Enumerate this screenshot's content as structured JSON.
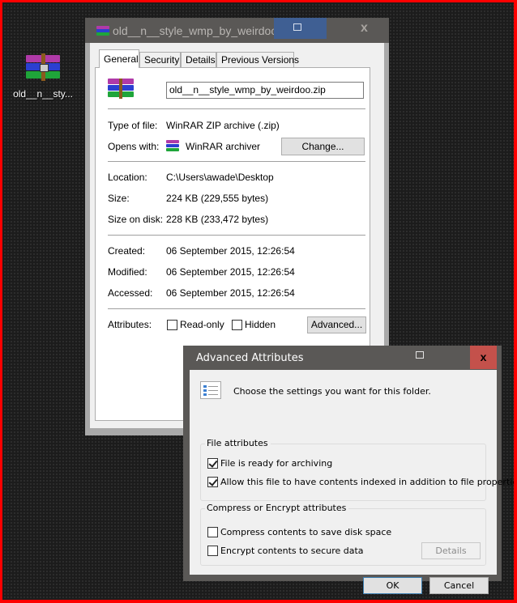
{
  "desktop": {
    "icon_label": "old__n__sty..."
  },
  "properties_window": {
    "title": "old__n__style_wmp_by_weirdoo.zip Prope",
    "tabs": [
      {
        "label": "General",
        "active": true
      },
      {
        "label": "Security",
        "active": false
      },
      {
        "label": "Details",
        "active": false
      },
      {
        "label": "Previous Versions",
        "active": false
      }
    ],
    "file_name": "old__n__style_wmp_by_weirdoo.zip",
    "type_of_file_label": "Type of file:",
    "type_of_file_value": "WinRAR ZIP archive (.zip)",
    "opens_with_label": "Opens with:",
    "opens_with_value": "WinRAR archiver",
    "change_button": "Change...",
    "location_label": "Location:",
    "location_value": "C:\\Users\\awade\\Desktop",
    "size_label": "Size:",
    "size_value": "224 KB (229,555 bytes)",
    "size_on_disk_label": "Size on disk:",
    "size_on_disk_value": "228 KB (233,472 bytes)",
    "created_label": "Created:",
    "created_value": "06 September 2015, 12:26:54",
    "modified_label": "Modified:",
    "modified_value": "06 September 2015, 12:26:54",
    "accessed_label": "Accessed:",
    "accessed_value": "06 September 2015, 12:26:54",
    "attributes_label": "Attributes:",
    "readonly_label": "Read-only",
    "readonly_checked": false,
    "hidden_label": "Hidden",
    "hidden_checked": false,
    "advanced_button": "Advanced...",
    "close_glyph": "x"
  },
  "advanced_dialog": {
    "title": "Advanced Attributes",
    "close_glyph": "x",
    "intro": "Choose the settings you want for this folder.",
    "file_attributes_group": "File attributes",
    "archive_label": "File is ready for archiving",
    "archive_checked": true,
    "index_label": "Allow this file to have contents indexed in addition to file properties",
    "index_checked": true,
    "compress_group": "Compress or Encrypt attributes",
    "compress_label": "Compress contents to save disk space",
    "compress_checked": false,
    "encrypt_label": "Encrypt contents to secure data",
    "encrypt_checked": false,
    "details_button": "Details",
    "ok_button": "OK",
    "cancel_button": "Cancel"
  },
  "colors": {
    "frame_border": "#ff0000",
    "title_bar": "#5a5856",
    "snap_highlight": "#3f5f93",
    "close_hover": "#c4514b",
    "ok_border": "#3c7fb1"
  }
}
